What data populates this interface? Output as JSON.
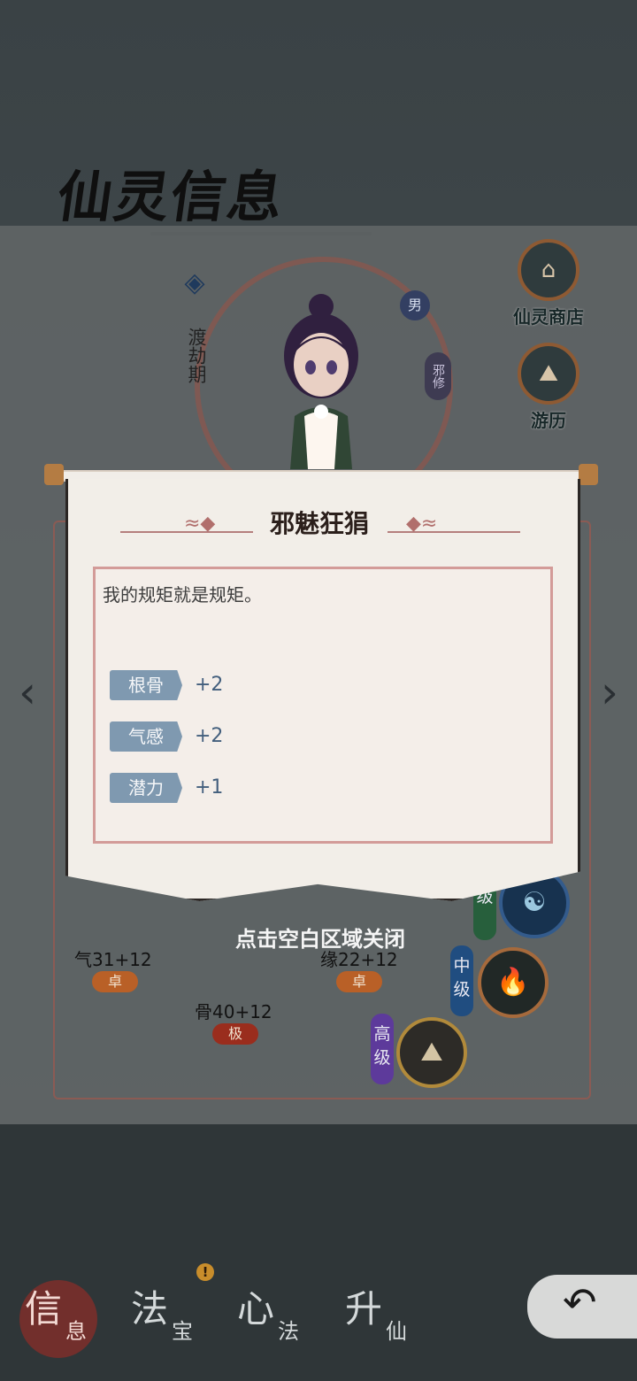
{
  "header": {
    "title": "仙灵信息"
  },
  "character": {
    "realm": "渡劫期",
    "gender": "男",
    "sect": "邪修"
  },
  "right_menu": [
    {
      "label": "仙灵商店",
      "icon": "shop-icon"
    },
    {
      "label": "游历",
      "icon": "journey-icon"
    }
  ],
  "stats": {
    "qi": {
      "value": "气31+12",
      "grade": "卓"
    },
    "yuan": {
      "value": "缘22+12",
      "grade": "卓"
    },
    "gu": {
      "value": "骨40+12",
      "grade": "极"
    }
  },
  "skill_tiers": [
    {
      "label": "级",
      "color": "#275f3c"
    },
    {
      "label": "中级",
      "color": "#204d80"
    },
    {
      "label": "高级",
      "color": "#5d3a9b"
    }
  ],
  "popup": {
    "title": "邪魅狂狷",
    "description": "我的规矩就是规矩。",
    "attributes": [
      {
        "label": "根骨",
        "value": "+2"
      },
      {
        "label": "气感",
        "value": "+2"
      },
      {
        "label": "潜力",
        "value": "+1"
      }
    ],
    "close_hint": "点击空白区域关闭"
  },
  "bottom_nav": [
    {
      "big": "信",
      "small": "息",
      "active": true
    },
    {
      "big": "法",
      "small": "宝",
      "active": false,
      "alert": "!"
    },
    {
      "big": "心",
      "small": "法",
      "active": false
    },
    {
      "big": "升",
      "small": "仙",
      "active": false
    }
  ],
  "colors": {
    "accent": "#b96027",
    "scroll": "#f2eee8",
    "attribute_label": "#7f99b0"
  }
}
